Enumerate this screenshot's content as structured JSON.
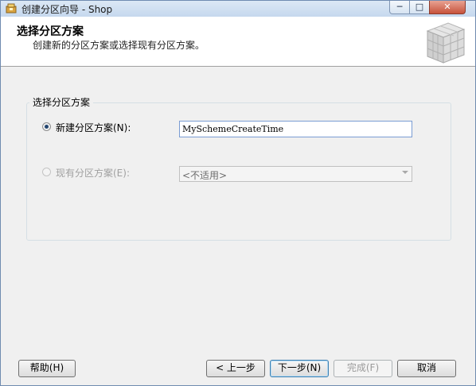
{
  "window": {
    "title": "创建分区向导 - Shop"
  },
  "title_controls": {
    "minimize": "─",
    "maximize": "□",
    "close": "✕"
  },
  "banner": {
    "title": "选择分区方案",
    "subtitle": "创建新的分区方案或选择现有分区方案。"
  },
  "group": {
    "label": "选择分区方案",
    "new_option": {
      "label": "新建分区方案(N):",
      "selected": true,
      "value": "MySchemeCreateTime"
    },
    "existing_option": {
      "label": "现有分区方案(E):",
      "selected": false,
      "enabled": false,
      "selected_value": "<不适用>"
    }
  },
  "buttons": {
    "help": "帮助(H)",
    "back": "< 上一步",
    "next": "下一步(N)",
    "finish": "完成(F)",
    "cancel": "取消"
  },
  "icons": {
    "app": "wizard-app-icon",
    "banner": "database-cube-icon"
  },
  "colors": {
    "titlebar": "#c5d8ee",
    "banner_bg": "#ffffff",
    "dialog_bg": "#f0f0f0",
    "focus_border": "#7a9cd3"
  }
}
